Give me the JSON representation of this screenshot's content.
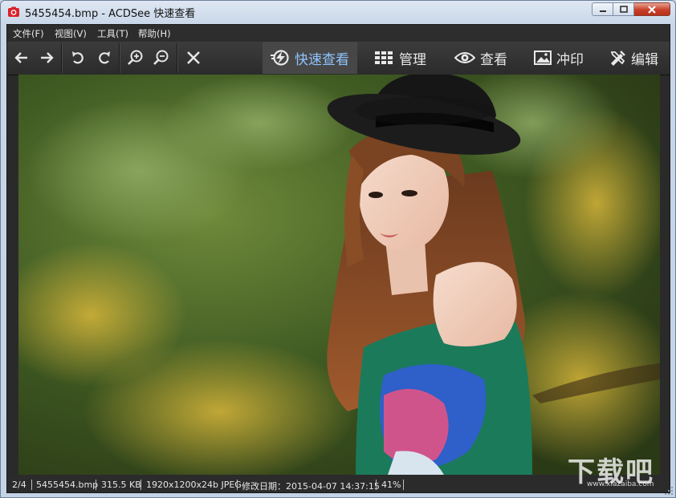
{
  "window": {
    "title": "5455454.bmp - ACDSee 快速查看",
    "icon": "camera-icon",
    "controls": [
      "minimize-icon",
      "maximize-icon",
      "close-icon"
    ]
  },
  "menu": [
    {
      "label": "文件(F)"
    },
    {
      "label": "视图(V)"
    },
    {
      "label": "工具(T)"
    },
    {
      "label": "帮助(H)"
    }
  ],
  "toolbar": {
    "buttons": [
      "arrow-left-icon",
      "arrow-right-icon",
      "rotate-left-icon",
      "rotate-right-icon",
      "zoom-in-icon",
      "zoom-out-icon",
      "close-x-icon"
    ],
    "modes": [
      {
        "label": "快速查看",
        "icon": "lightning-icon",
        "active": true
      },
      {
        "label": "管理",
        "icon": "grid-icon",
        "active": false
      },
      {
        "label": "查看",
        "icon": "eye-icon",
        "active": false
      },
      {
        "label": "冲印",
        "icon": "picture-icon",
        "active": false
      },
      {
        "label": "编辑",
        "icon": "edit-tools-icon",
        "active": false
      }
    ],
    "active_color": "#8fc3ff"
  },
  "image": {
    "subject": "photo-portrait"
  },
  "status": {
    "position": "2/4",
    "filename": "5455454.bmp",
    "size": "315.5 KB",
    "dimensions": "1920x1200x24b JPEG",
    "modified": "修改日期：2015-04-07 14:37:15",
    "zoom": "41%"
  },
  "watermark": {
    "text": "下载吧",
    "url": "www.xiazaiba.com"
  }
}
